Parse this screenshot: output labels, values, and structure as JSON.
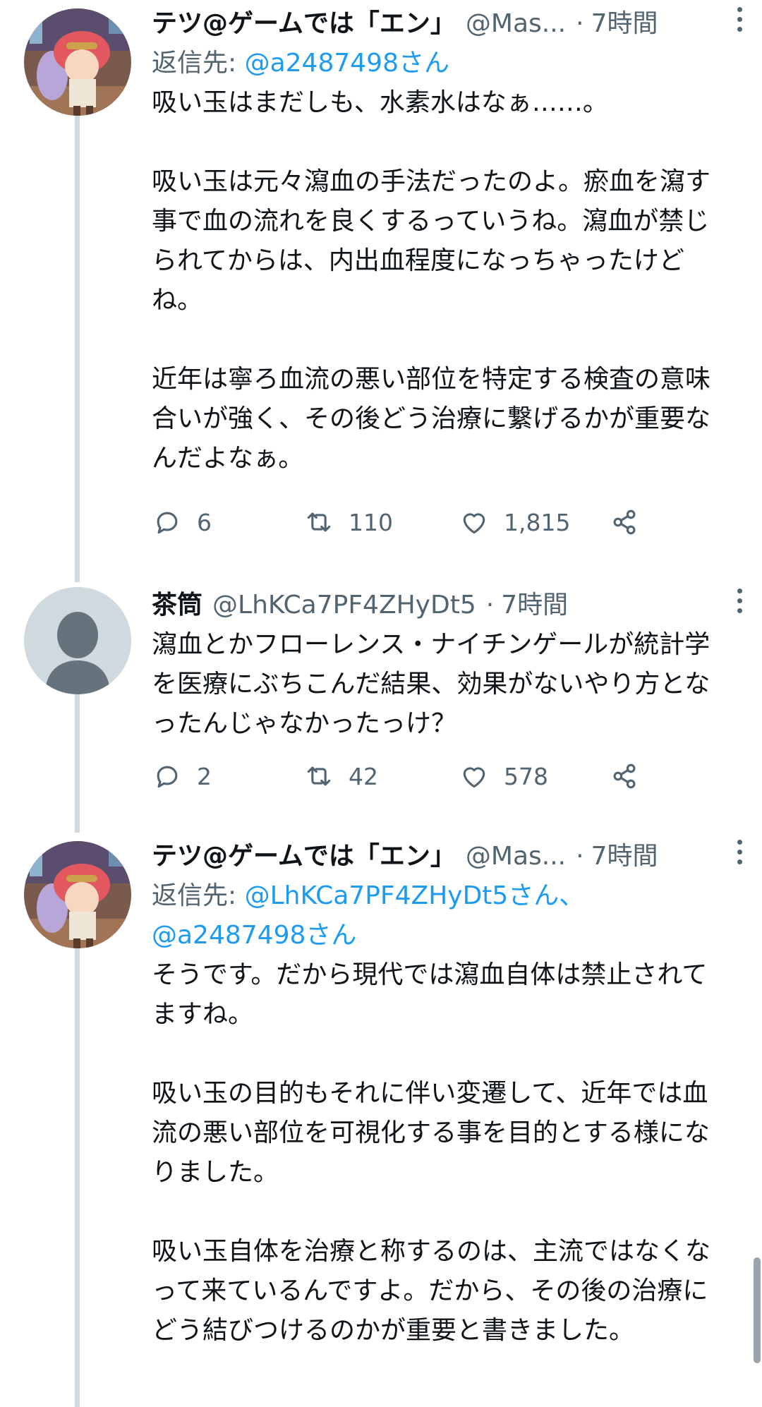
{
  "tweets": [
    {
      "name": "テツ@ゲームでは「エン」",
      "handle": "@Mas...",
      "sep": "·",
      "time": "7時間",
      "reply_label": "返信先:",
      "reply_to": "@a2487498さん",
      "text": "吸い玉はまだしも、水素水はなぁ……。\n\n吸い玉は元々瀉血の手法だったのよ。瘀血を瀉す事で血の流れを良くするっていうね。瀉血が禁じられてからは、内出血程度になっちゃったけどね。\n\n近年は寧ろ血流の悪い部位を特定する検査の意味合いが強く、その後どう治療に繋げるかが重要なんだよなぁ。",
      "replies": "6",
      "retweets": "110",
      "likes": "1,815"
    },
    {
      "name": "茶筒",
      "handle": "@LhKCa7PF4ZHyDt5",
      "sep": "·",
      "time": "7時間",
      "text": "瀉血とかフローレンス・ナイチンゲールが統計学を医療にぶちこんだ結果、効果がないやり方となったんじゃなかったっけ？",
      "replies": "2",
      "retweets": "42",
      "likes": "578"
    },
    {
      "name": "テツ@ゲームでは「エン」",
      "handle": "@Mas...",
      "sep": "·",
      "time": "7時間",
      "reply_label": "返信先:",
      "reply_to": "@LhKCa7PF4ZHyDt5さん、",
      "reply_to_2": "@a2487498さん",
      "text": "そうです。だから現代では瀉血自体は禁止されてますね。\n\n吸い玉の目的もそれに伴い変遷して、近年では血流の悪い部位を可視化する事を目的とする様になりました。\n\n吸い玉自体を治療と称するのは、主流ではなくなって来ているんですよ。だから、その後の治療にどう結びつけるのかが重要と書きました。"
    }
  ],
  "colors": {
    "text": "#0f1419",
    "secondary": "#536471",
    "link": "#1d9bf0",
    "thread_line": "#cfd9de"
  }
}
